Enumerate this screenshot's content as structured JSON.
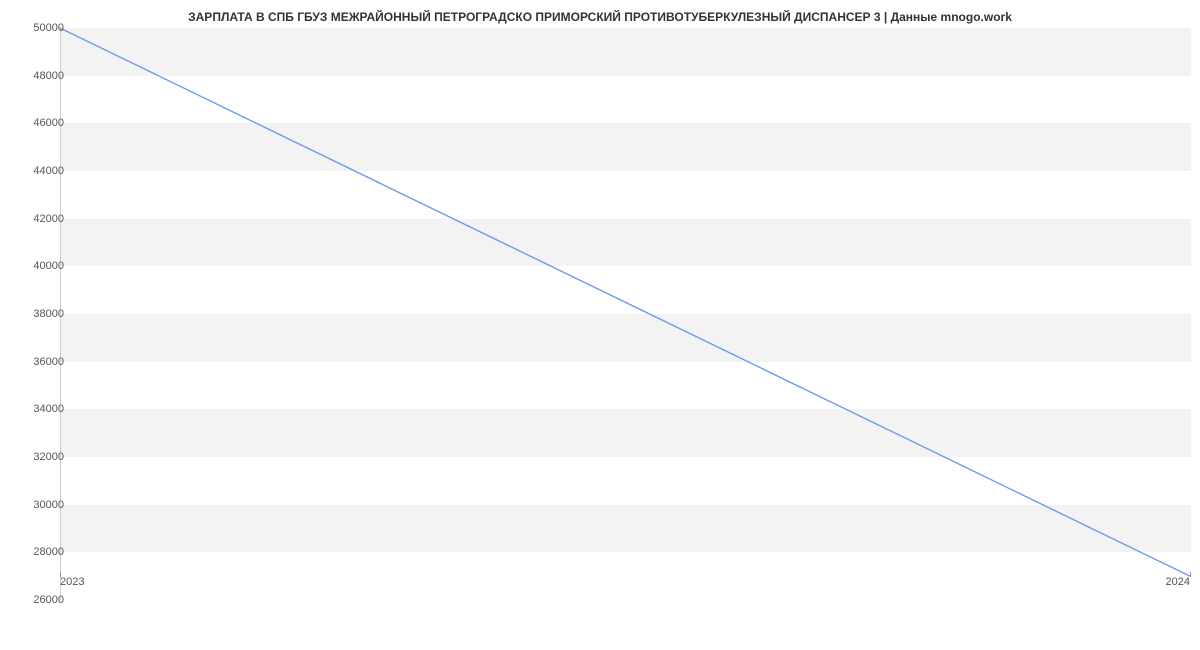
{
  "chart_data": {
    "type": "line",
    "title": "ЗАРПЛАТА В СПБ ГБУЗ МЕЖРАЙОННЫЙ ПЕТРОГРАДСКО ПРИМОРСКИЙ ПРОТИВОТУБЕРКУЛЕЗНЫЙ ДИСПАНСЕР 3 | Данные mnogo.work",
    "x": [
      "2023",
      "2024"
    ],
    "values": [
      50000,
      27000
    ],
    "xlabel": "",
    "ylabel": "",
    "ylim": [
      26000,
      50000
    ],
    "yticks": [
      26000,
      28000,
      30000,
      32000,
      34000,
      36000,
      38000,
      40000,
      42000,
      44000,
      46000,
      48000,
      50000
    ],
    "xticks": [
      "2023",
      "2024"
    ],
    "line_color": "#6b9be8"
  }
}
